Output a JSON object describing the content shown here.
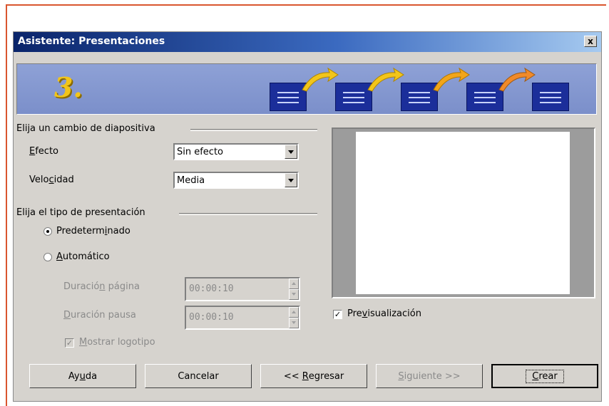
{
  "window": {
    "title": "Asistente: Presentaciones",
    "close_label": "x"
  },
  "banner": {
    "step_number": "3."
  },
  "transition_group": {
    "label": "Elija un cambio de diapositiva",
    "effect": {
      "label_pre": "",
      "label_key": "E",
      "label_post": "fecto",
      "value": "Sin efecto"
    },
    "speed": {
      "label_pre": "Velo",
      "label_key": "c",
      "label_post": "idad",
      "value": "Media"
    }
  },
  "presentation_group": {
    "label": "Elija el tipo de presentación",
    "default_radio": {
      "label_pre": "Predeterm",
      "label_key": "i",
      "label_post": "nado",
      "selected": true
    },
    "auto_radio": {
      "label_pre": "",
      "label_key": "A",
      "label_post": "utomático",
      "selected": false
    },
    "page_duration": {
      "label_pre": "Duració",
      "label_key": "n",
      "label_post": " página",
      "value": "00:00:10"
    },
    "pause_duration": {
      "label_pre": "",
      "label_key": "D",
      "label_post": "uración pausa",
      "value": "00:00:10"
    },
    "show_logo": {
      "label_pre": "",
      "label_key": "M",
      "label_post": "ostrar logotipo",
      "checked": true
    }
  },
  "preview_check": {
    "label_pre": "Pre",
    "label_key": "v",
    "label_post": "isualización",
    "checked": true
  },
  "buttons": {
    "help": {
      "pre": "Ay",
      "key": "u",
      "post": "da"
    },
    "cancel": {
      "pre": "",
      "key": "",
      "post": "Cancelar"
    },
    "back": {
      "pre": "<< ",
      "key": "R",
      "post": "egresar"
    },
    "next": {
      "pre": "",
      "key": "S",
      "post": "iguiente >>"
    },
    "create": {
      "pre": "",
      "key": "C",
      "post": "rear"
    }
  },
  "colors": {
    "frame_accent": "#d9562f",
    "titlebar_start": "#0a246a",
    "titlebar_end": "#a6caf0",
    "banner_bg": "#8ea1d6",
    "step_number": "#f2c51a",
    "slide_icon": "#1b2e9a",
    "arrow": "#f2c51a"
  }
}
